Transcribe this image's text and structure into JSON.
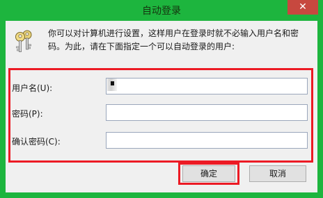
{
  "window": {
    "title": "自动登录",
    "close_glyph": "✕"
  },
  "dialog": {
    "icon": "keys-icon",
    "description": "你可以对计算机进行设置，这样用户在登录时就不必输入用户名和密码。为此，请在下面指定一个可以自动登录的用户:"
  },
  "fields": {
    "username": {
      "label": "用户名(U):",
      "value": ""
    },
    "password": {
      "label": "密码(P):",
      "value": ""
    },
    "confirm_password": {
      "label": "确认密码(C):",
      "value": ""
    }
  },
  "buttons": {
    "ok": "确定",
    "cancel": "取消"
  },
  "colors": {
    "window_frame": "#1db53e",
    "close_button": "#c7483f",
    "highlight": "#ec1a24",
    "client_background": "#f0f0f0"
  }
}
